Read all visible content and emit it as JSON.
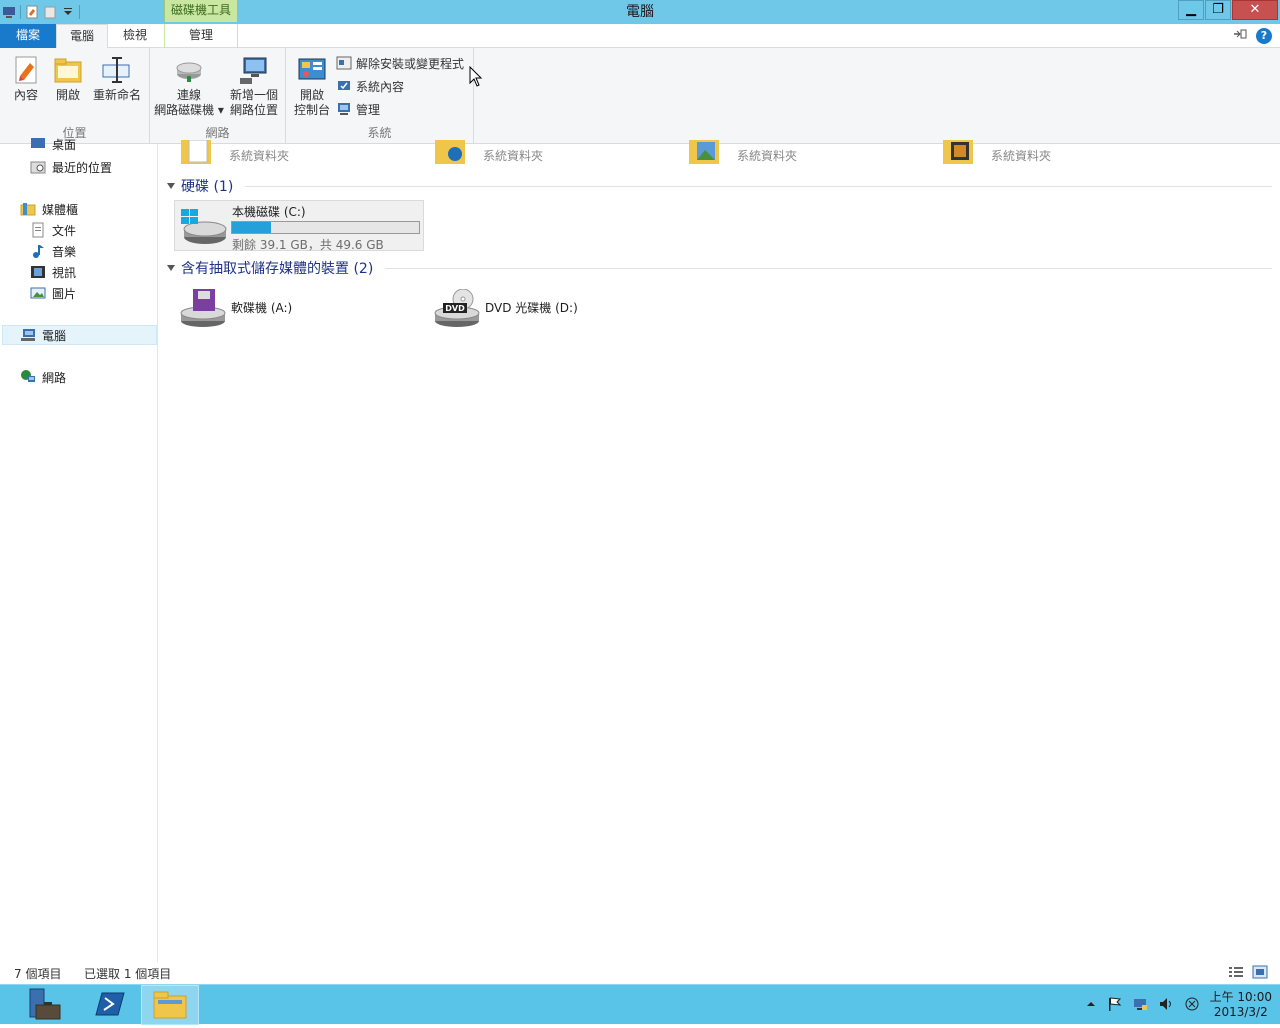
{
  "window": {
    "title": "電腦",
    "context_tab": "磁碟機工具",
    "buttons": {
      "minimize": "▁",
      "maximize": "❐",
      "close": "✕"
    }
  },
  "tabs": {
    "file": "檔案",
    "computer": "電腦",
    "view": "檢視",
    "manage": "管理",
    "help": "?"
  },
  "ribbon": {
    "location": {
      "label": "位置",
      "properties": "內容",
      "open": "開啟",
      "rename": "重新命名"
    },
    "network": {
      "label": "網路",
      "map_drive_line1": "連線",
      "map_drive_line2": "網路磁碟機",
      "add_location_line1": "新增一個",
      "add_location_line2": "網路位置"
    },
    "system": {
      "label": "系統",
      "control_panel_line1": "開啟",
      "control_panel_line2": "控制台",
      "uninstall": "解除安裝或變更程式",
      "system_properties": "系統內容",
      "manage": "管理"
    }
  },
  "nav": {
    "desktop": "桌面",
    "recent": "最近的位置",
    "libraries": "媒體櫃",
    "documents": "文件",
    "music": "音樂",
    "videos": "視訊",
    "pictures": "圖片",
    "computer": "電腦",
    "network": "網路"
  },
  "content": {
    "folders": [
      "系統資料夾",
      "系統資料夾",
      "系統資料夾",
      "系統資料夾"
    ],
    "hard_drives_header": "硬碟 (1)",
    "drive_c": {
      "name": "本機磁碟 (C:)",
      "free_text": "剩餘 39.1 GB，共 49.6 GB",
      "used_fraction": 0.21
    },
    "removable_header": "含有抽取式儲存媒體的裝置 (2)",
    "floppy": "軟碟機 (A:)",
    "dvd": "DVD 光碟機 (D:)",
    "dvd_badge": "DVD"
  },
  "status": {
    "count": "7 個項目",
    "selected": "已選取 1 個項目"
  },
  "taskbar": {
    "time": "上午 10:00",
    "date": "2013/3/2"
  },
  "colors": {
    "titlebar": "#70c8e8",
    "file_tab": "#1979ca",
    "drive_bar": "#26a0da",
    "taskbar": "#5ac3e8"
  }
}
